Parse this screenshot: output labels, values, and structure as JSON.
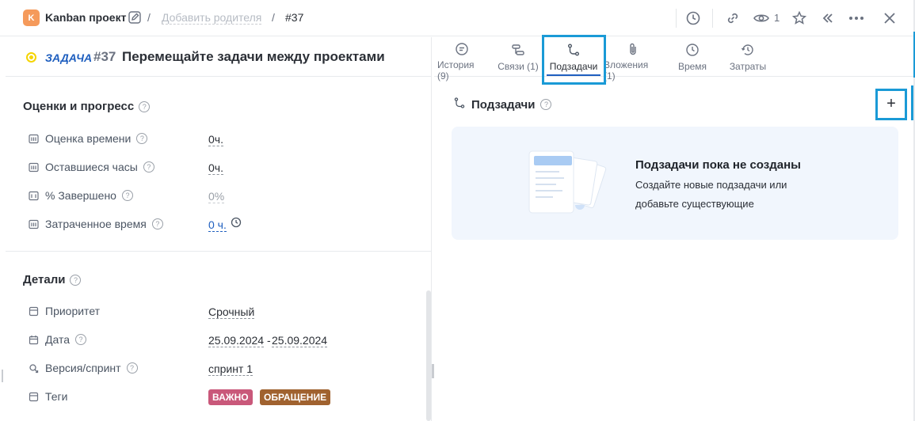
{
  "topbar": {
    "project_badge": "K",
    "project_name": "Kanban проект",
    "add_parent": "Добавить родителя",
    "task_number": "#37",
    "watchers_count": "1"
  },
  "task": {
    "type": "ЗАДАЧА",
    "id": "#37",
    "title": "Перемещайте задачи между проектами",
    "status_color": "#f5d400"
  },
  "estimates": {
    "heading": "Оценки и прогресс",
    "rows": [
      {
        "label": "Оценка времени",
        "value": "0ч."
      },
      {
        "label": "Оставшиеся часы",
        "value": "0ч."
      },
      {
        "label": "% Завершено",
        "value": "0%"
      },
      {
        "label": "Затраченное время",
        "value": "0 ч."
      }
    ]
  },
  "details": {
    "heading": "Детали",
    "priority_label": "Приоритет",
    "priority_value": "Срочный",
    "date_label": "Дата",
    "date_start": "25.09.2024",
    "date_sep": "-",
    "date_end": "25.09.2024",
    "version_label": "Версия/спринт",
    "version_value": "спринт 1",
    "tags_label": "Теги",
    "tags": [
      {
        "label": "ВАЖНО",
        "color": "#c9587a"
      },
      {
        "label": "ОБРАЩЕНИЕ",
        "color": "#a0622f"
      }
    ]
  },
  "tabs": [
    {
      "label": "История (9)",
      "icon": "history-icon"
    },
    {
      "label": "Связи (1)",
      "icon": "links-icon"
    },
    {
      "label": "Подзадачи",
      "icon": "subtasks-icon",
      "active": true
    },
    {
      "label": "Вложения (1)",
      "icon": "paperclip-icon"
    },
    {
      "label": "Время",
      "icon": "clock-icon"
    },
    {
      "label": "Затраты",
      "icon": "costs-icon"
    }
  ],
  "subtasks": {
    "heading": "Подзадачи",
    "add_symbol": "+",
    "empty_title": "Подзадачи пока не созданы",
    "empty_line1": "Создайте новые подзадачи или",
    "empty_line2": "добавьте существующие"
  },
  "colors": {
    "accent": "#1f5fbf",
    "highlight": "#1a9ad6"
  }
}
